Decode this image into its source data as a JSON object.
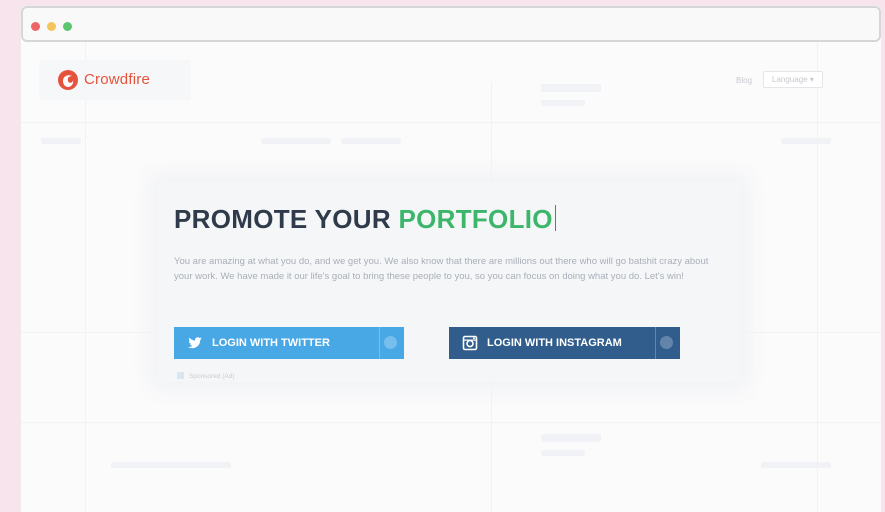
{
  "browser": {
    "controls": [
      "close",
      "minimize",
      "maximize"
    ]
  },
  "header": {
    "brand": "Crowdfire",
    "nav_blog": "Blog",
    "nav_language": "Language"
  },
  "modal": {
    "headline_main": "PROMOTE YOUR",
    "headline_accent": "PORTFOLIO",
    "description": "You are amazing at what you do, and we get you. We also know that there are millions out there who will go batshit crazy about your work. We have made it our life's goal to bring these people to you, so you can focus on doing what you do. Let's win!",
    "twitter_button": "LOGIN WITH TWITTER",
    "instagram_button": "LOGIN WITH INSTAGRAM",
    "footnote": "Sponsored (Ad)"
  },
  "colors": {
    "brand": "#e5533d",
    "accent": "#3cb66a",
    "twitter": "#48a8e6",
    "instagram": "#305d8c"
  },
  "icons": {
    "logo": "crowdfire-logo-icon",
    "twitter": "twitter-bird-icon",
    "instagram": "instagram-camera-icon",
    "info": "info-icon"
  }
}
